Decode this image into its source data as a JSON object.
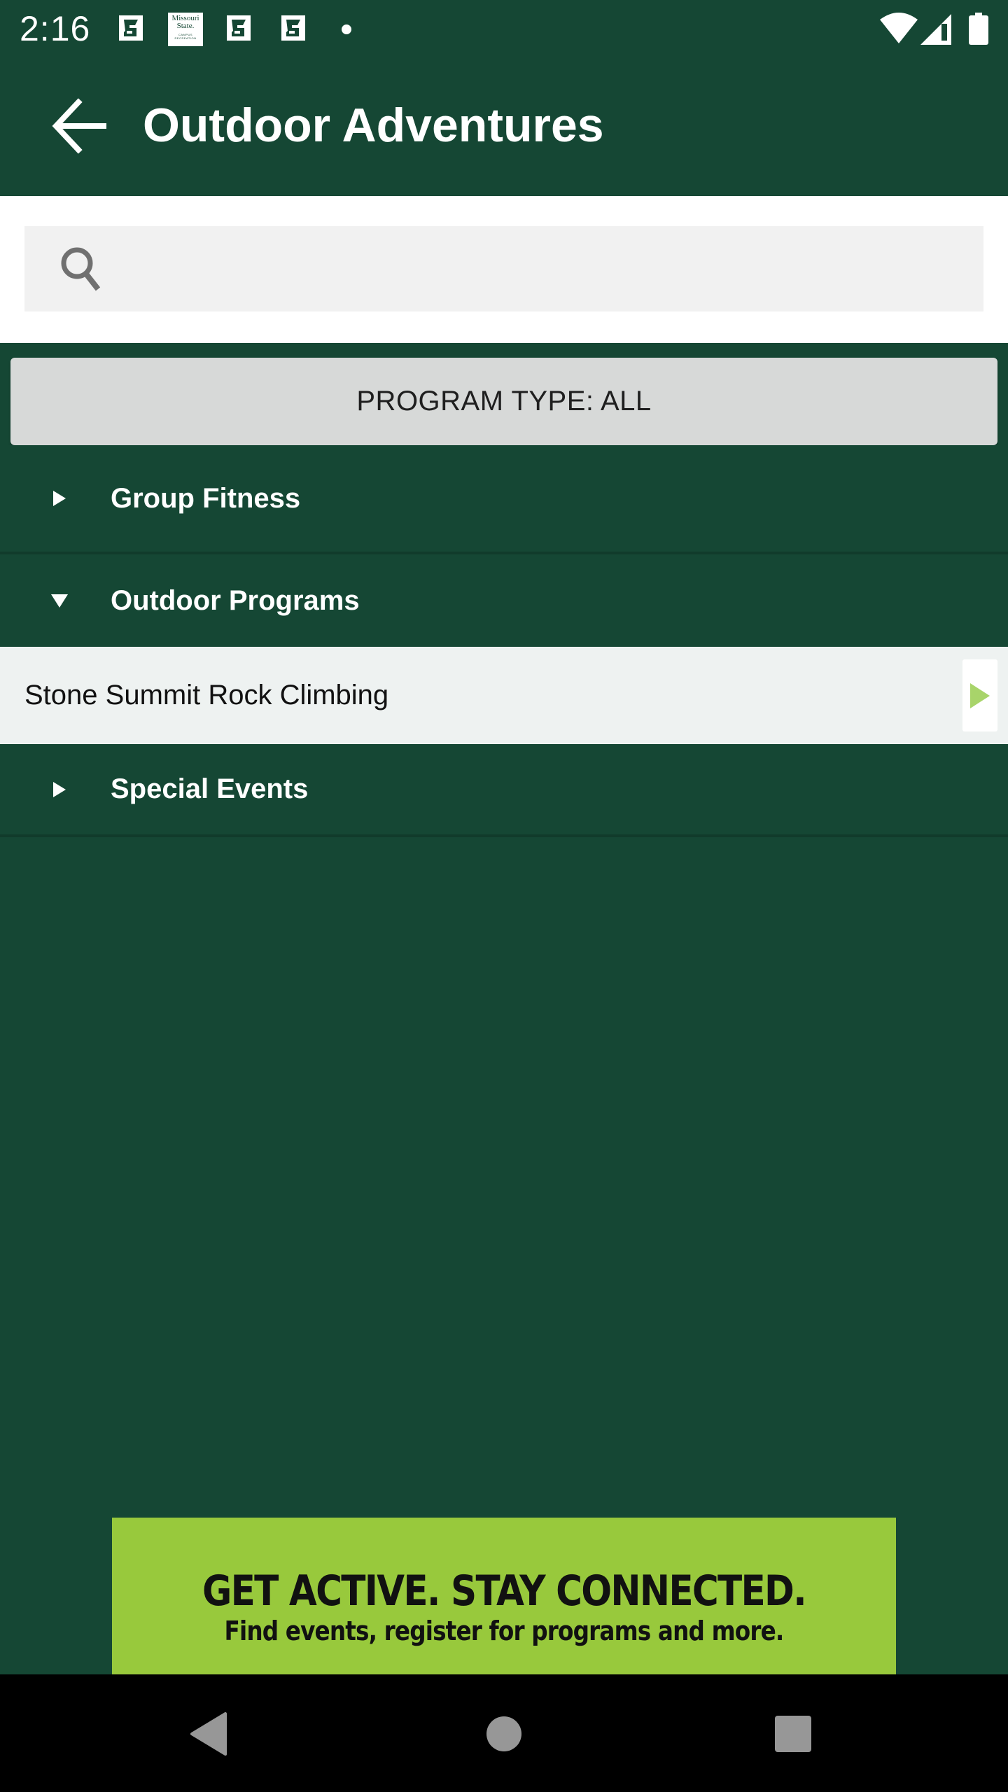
{
  "status_bar": {
    "time": "2:16",
    "notification_icons": [
      "fitness-app-icon",
      "missouri-state-campus-recreation-icon",
      "fitness-app-icon",
      "fitness-app-icon",
      "more-notifications-dot"
    ],
    "missouri_state_logo": {
      "line1": "Missouri",
      "line2": "State.",
      "line3": "CAMPUS RECREATION"
    },
    "system_icons": [
      "wifi-icon",
      "cellular-signal-icon",
      "battery-icon"
    ]
  },
  "app_bar": {
    "back_icon": "arrow-back-icon",
    "title": "Outdoor Adventures"
  },
  "search": {
    "icon": "search-icon",
    "value": "",
    "placeholder": ""
  },
  "filter": {
    "program_type_label": "PROGRAM TYPE: ALL"
  },
  "categories": [
    {
      "label": "Group Fitness",
      "expanded": false,
      "items": []
    },
    {
      "label": "Outdoor Programs",
      "expanded": true,
      "items": [
        {
          "label": "Stone Summit Rock Climbing",
          "arrow_icon": "play-arrow-icon"
        }
      ]
    },
    {
      "label": "Special Events",
      "expanded": false,
      "items": []
    }
  ],
  "banner": {
    "headline": "GET ACTIVE.  STAY CONNECTED.",
    "subtext": "Find events, register for programs and more."
  },
  "nav_bar": {
    "buttons": [
      "back-nav-icon",
      "home-nav-icon",
      "recents-nav-icon"
    ]
  },
  "colors": {
    "brand_green": "#154734",
    "accent_lime": "#98c93c",
    "arrow_lime": "#a8d46a",
    "filter_button": "#d7d9d8",
    "sub_row_bg": "#eef2f1"
  }
}
